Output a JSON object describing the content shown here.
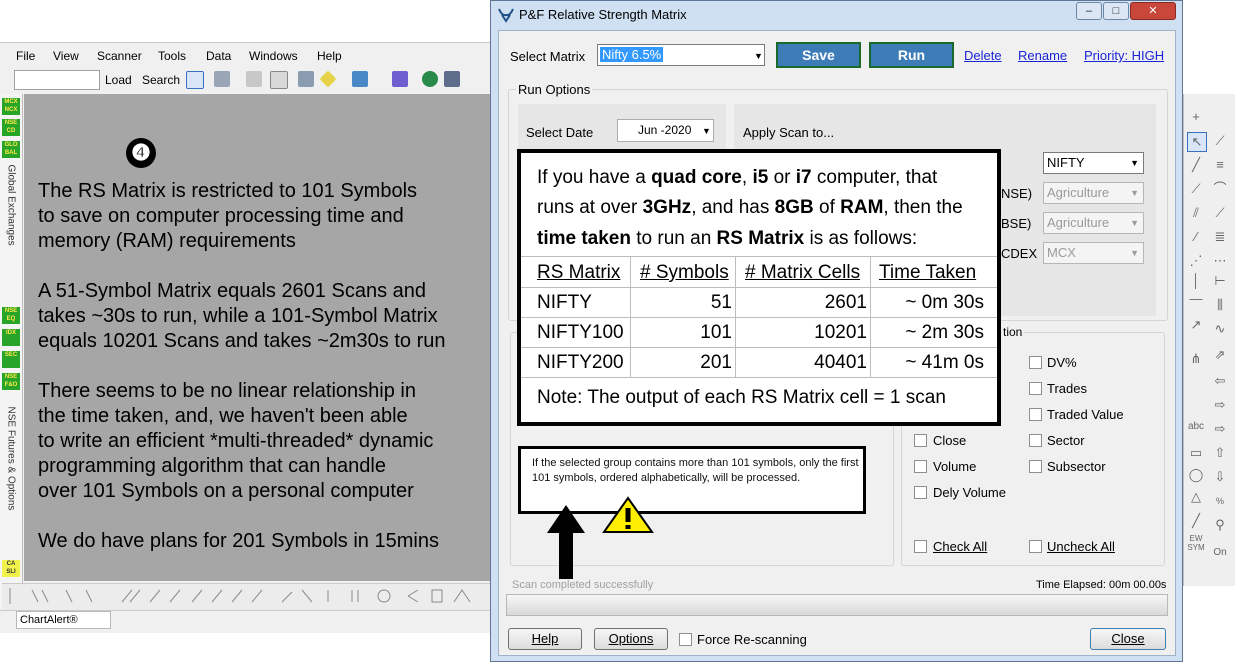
{
  "main_app": {
    "menu": [
      "File",
      "View",
      "Scanner",
      "Tools",
      "Data",
      "Windows",
      "Help"
    ],
    "toolbar": {
      "load": "Load",
      "search": "Search"
    },
    "left_strip": {
      "badges_top": [
        "MCX NCX",
        "NSE CD",
        "GLO BAL"
      ],
      "label_top": "Global Exchanges",
      "badges_mid": [
        "NSE EQ",
        "IDX",
        "SEC",
        "NSE F&O"
      ],
      "label_mid": "NSE Futures & Options",
      "badge_bottom": "CA SLI"
    },
    "panel": {
      "number": "❹",
      "lines": [
        "The RS Matrix is restricted to 101 Symbols",
        "to save on computer processing time and",
        "memory (RAM) requirements",
        "",
        "A 51-Symbol Matrix equals 2601 Scans and",
        "takes ~30s to run, while a 101-Symbol Matrix",
        "equals 10201 Scans and takes ~2m30s to run",
        "",
        "There seems to be no linear relationship in",
        "the time taken, and, we haven't been able",
        "to write an efficient *multi-threaded* dynamic",
        "programming algorithm that can handle",
        "over 101 Symbols on a personal computer",
        "",
        "We do have plans for 201 Symbols in 15mins"
      ]
    },
    "status_text": "ChartAlert®"
  },
  "dialog": {
    "title": "P&F Relative Strength Matrix",
    "window_buttons": [
      "–",
      "□",
      "✕"
    ],
    "select_matrix_label": "Select Matrix",
    "select_matrix_value": "Nifty 6.5%",
    "save_label": "Save",
    "run_label": "Run",
    "links": [
      "Delete",
      "Rename",
      "Priority: HIGH"
    ],
    "run_options_label": "Run Options",
    "select_date_label": "Select Date",
    "date_value": "Jun -2020",
    "apply_scan_label": "Apply Scan to...",
    "group_combo_value": "NIFTY",
    "exchange_rows": [
      {
        "suffix": "NSE)",
        "value": "Agriculture"
      },
      {
        "suffix": "BSE)",
        "value": "Agriculture"
      },
      {
        "suffix": "CDEX",
        "value": "MCX"
      }
    ],
    "options_title_fragment": "tion",
    "checkboxes_left": [
      "Close",
      "Volume",
      "Dely Volume"
    ],
    "checkboxes_right": [
      "DV%",
      "Trades",
      "Traded Value",
      "Sector",
      "Subsector"
    ],
    "check_all": "Check All",
    "uncheck_all": "Uncheck All",
    "scan_status": "Scan completed successfully",
    "time_elapsed": "Time Elapsed: 00m 00.00s",
    "help": "Help",
    "options": "Options",
    "force_rescan": "Force Re-scanning",
    "close": "Close"
  },
  "info_box": {
    "intro": [
      "If you have a ",
      "quad core",
      ", ",
      "i5",
      " or ",
      "i7",
      " computer, that"
    ],
    "line2": [
      "runs at over ",
      "3GHz",
      ", and has ",
      "8GB",
      " of ",
      "RAM",
      ", then the"
    ],
    "line3": [
      "time taken",
      " to run an ",
      "RS Matrix",
      " is as follows:"
    ],
    "headers": [
      "RS Matrix",
      "# Symbols",
      "# Matrix Cells",
      "Time Taken"
    ],
    "rows": [
      [
        "NIFTY",
        "51",
        "2601",
        "~ 0m 30s"
      ],
      [
        "NIFTY100",
        "101",
        "10201",
        "~ 2m 30s"
      ],
      [
        "NIFTY200",
        "201",
        "40401",
        "~ 41m 0s"
      ]
    ],
    "note": "Note: The output of each RS Matrix cell = 1 scan"
  },
  "note_box": {
    "text": "If the selected group contains more than 101 symbols, only the first 101 symbols, ordered alphabetically, will be processed."
  },
  "colors": {
    "dialog_frame": "#cfe0f3",
    "accent_button": "#3e7cb8",
    "link": "#1a25d6",
    "panel_gray": "#a6a6a6"
  }
}
